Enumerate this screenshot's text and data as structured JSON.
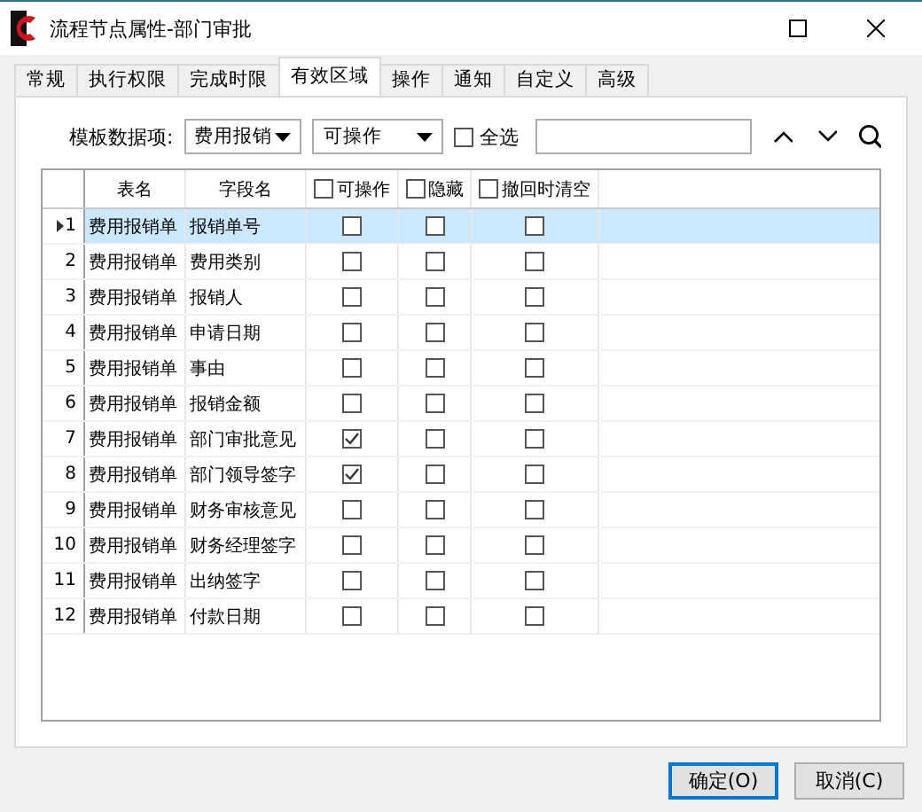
{
  "window": {
    "title": "流程节点属性-部门审批"
  },
  "tabs": [
    {
      "label": "常规",
      "selected": false
    },
    {
      "label": "执行权限",
      "selected": false
    },
    {
      "label": "完成时限",
      "selected": false
    },
    {
      "label": "有效区域",
      "selected": true
    },
    {
      "label": "操作",
      "selected": false
    },
    {
      "label": "通知",
      "selected": false
    },
    {
      "label": "自定义",
      "selected": false
    },
    {
      "label": "高级",
      "selected": false
    }
  ],
  "filter": {
    "label": "模板数据项:",
    "template_select": "费用报销",
    "mode_select": "可操作",
    "select_all": {
      "label": "全选",
      "checked": false
    }
  },
  "table": {
    "columns": [
      {
        "label": "表名",
        "kind": "text"
      },
      {
        "label": "字段名",
        "kind": "text"
      },
      {
        "label": "可操作",
        "kind": "checkbox",
        "checked": false
      },
      {
        "label": "隐藏",
        "kind": "checkbox",
        "checked": false
      },
      {
        "label": "撤回时清空",
        "kind": "checkbox",
        "checked": false
      }
    ],
    "rows": [
      {
        "index": "1",
        "table": "费用报销单",
        "field": "报销单号",
        "editable": false,
        "hidden": false,
        "clear_on_withdraw": false,
        "selected": true
      },
      {
        "index": "2",
        "table": "费用报销单",
        "field": "费用类别",
        "editable": false,
        "hidden": false,
        "clear_on_withdraw": false,
        "selected": false
      },
      {
        "index": "3",
        "table": "费用报销单",
        "field": "报销人",
        "editable": false,
        "hidden": false,
        "clear_on_withdraw": false,
        "selected": false
      },
      {
        "index": "4",
        "table": "费用报销单",
        "field": "申请日期",
        "editable": false,
        "hidden": false,
        "clear_on_withdraw": false,
        "selected": false
      },
      {
        "index": "5",
        "table": "费用报销单",
        "field": "事由",
        "editable": false,
        "hidden": false,
        "clear_on_withdraw": false,
        "selected": false
      },
      {
        "index": "6",
        "table": "费用报销单",
        "field": "报销金额",
        "editable": false,
        "hidden": false,
        "clear_on_withdraw": false,
        "selected": false
      },
      {
        "index": "7",
        "table": "费用报销单",
        "field": "部门审批意见",
        "editable": true,
        "hidden": false,
        "clear_on_withdraw": false,
        "selected": false
      },
      {
        "index": "8",
        "table": "费用报销单",
        "field": "部门领导签字",
        "editable": true,
        "hidden": false,
        "clear_on_withdraw": false,
        "selected": false
      },
      {
        "index": "9",
        "table": "费用报销单",
        "field": "财务审核意见",
        "editable": false,
        "hidden": false,
        "clear_on_withdraw": false,
        "selected": false
      },
      {
        "index": "10",
        "table": "费用报销单",
        "field": "财务经理签字",
        "editable": false,
        "hidden": false,
        "clear_on_withdraw": false,
        "selected": false
      },
      {
        "index": "11",
        "table": "费用报销单",
        "field": "出纳签字",
        "editable": false,
        "hidden": false,
        "clear_on_withdraw": false,
        "selected": false
      },
      {
        "index": "12",
        "table": "费用报销单",
        "field": "付款日期",
        "editable": false,
        "hidden": false,
        "clear_on_withdraw": false,
        "selected": false
      }
    ]
  },
  "buttons": [
    {
      "label": "确定(O)",
      "default": true
    },
    {
      "label": "取消(C)",
      "default": false
    }
  ]
}
